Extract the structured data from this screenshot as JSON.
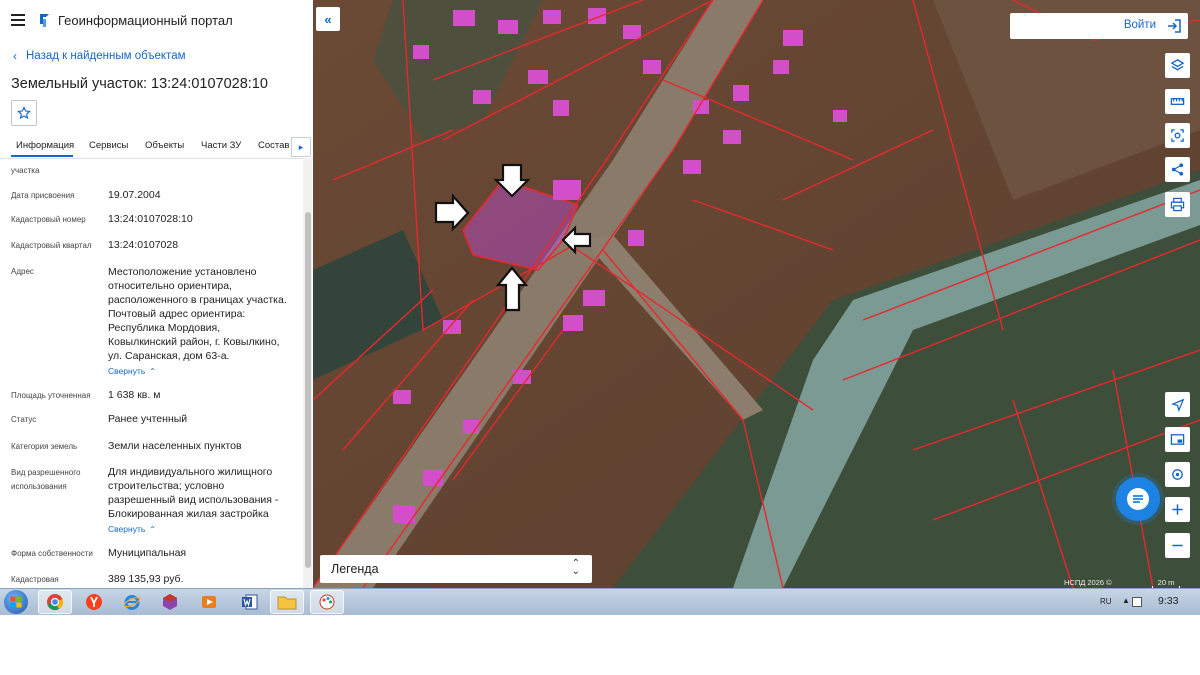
{
  "app": {
    "title": "Геоинформационный портал",
    "back_label": "Назад к найденным объектам",
    "object_title": "Земельный участок: 13:24:0107028:10"
  },
  "tabs": [
    "Информация",
    "Сервисы",
    "Объекты",
    "Части ЗУ",
    "Состав"
  ],
  "properties": [
    {
      "label": "участка",
      "value": ""
    },
    {
      "label": "Дата присвоения",
      "value": "19.07.2004"
    },
    {
      "label": "Кадастровый номер",
      "value": "13:24:0107028:10"
    },
    {
      "label": "Кадастровый квартал",
      "value": "13:24:0107028"
    },
    {
      "label": "Адрес",
      "value_lines": [
        "Местоположение установлено",
        "относительно ориентира,",
        "расположенного в границах участка.",
        "Почтовый адрес ориентира:",
        "Республика Мордовия,",
        "Ковылкинский район, г. Ковылкино,",
        "ул. Саранская, дом 63-а."
      ]
    },
    {
      "label": "Площадь уточненная",
      "value": "1 638 кв. м"
    },
    {
      "label": "Статус",
      "value": "Ранее учтенный"
    },
    {
      "label": "Категория земель",
      "value": "Земли населенных пунктов"
    },
    {
      "label_lines": [
        "Вид разрешенного",
        "использования"
      ],
      "value_lines": [
        "Для индивидуального жилищного",
        "строительства; условно",
        "разрешенный вид использования -",
        "Блокированная жилая застройка"
      ]
    },
    {
      "label": "Форма собственности",
      "value": "Муниципальная"
    },
    {
      "label": "Кадастровая",
      "value": "389 135,93 руб."
    }
  ],
  "collapse_label": "Свернуть",
  "map": {
    "login_label": "Войти",
    "legend_label": "Легенда",
    "attribution": "НСПД 2026 ©",
    "scale_label": "20 m",
    "parcel_line_color": "#e8282e",
    "highlight_color": "#c24bd6",
    "river_color": "#7a9a93"
  },
  "taskbar": {
    "language": "RU",
    "time": "9:33"
  }
}
